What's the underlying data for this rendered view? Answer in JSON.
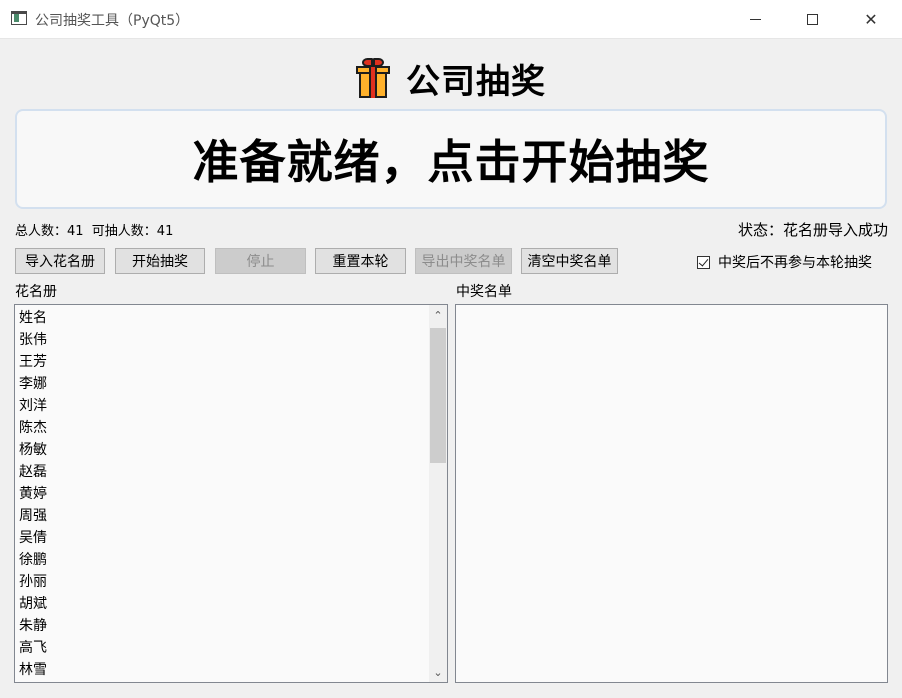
{
  "window": {
    "title": "公司抽奖工具（PyQt5）",
    "close_symbol": "✕"
  },
  "header": {
    "title": "公司抽奖",
    "icon": "gift-icon"
  },
  "banner": {
    "text": "准备就绪，点击开始抽奖"
  },
  "info": {
    "counts": "总人数：41  可抽人数：41",
    "status": "状态：花名册导入成功"
  },
  "toolbar": {
    "import_label": "导入花名册",
    "start_label": "开始抽奖",
    "stop_label": "停止",
    "reset_label": "重置本轮",
    "export_label": "导出中奖名单",
    "clear_label": "清空中奖名单",
    "exclude_winners_label": "中奖后不再参与本轮抽奖",
    "exclude_winners_checked": true
  },
  "roster": {
    "label": "花名册",
    "items": [
      "姓名",
      "张伟",
      "王芳",
      "李娜",
      "刘洋",
      "陈杰",
      "杨敏",
      "赵磊",
      "黄婷",
      "周强",
      "吴倩",
      "徐鹏",
      "孙丽",
      "胡斌",
      "朱静",
      "高飞",
      "林雪"
    ],
    "scroll_up_symbol": "⌃",
    "scroll_down_symbol": "⌄",
    "scroll_thumb_start": 0.0,
    "scroll_thumb_size": 0.4
  },
  "winners": {
    "label": "中奖名单",
    "items": []
  },
  "colors": {
    "gift_box": "#ffb12b",
    "gift_ribbon": "#e0301e",
    "banner_border": "#d3e0ef"
  }
}
